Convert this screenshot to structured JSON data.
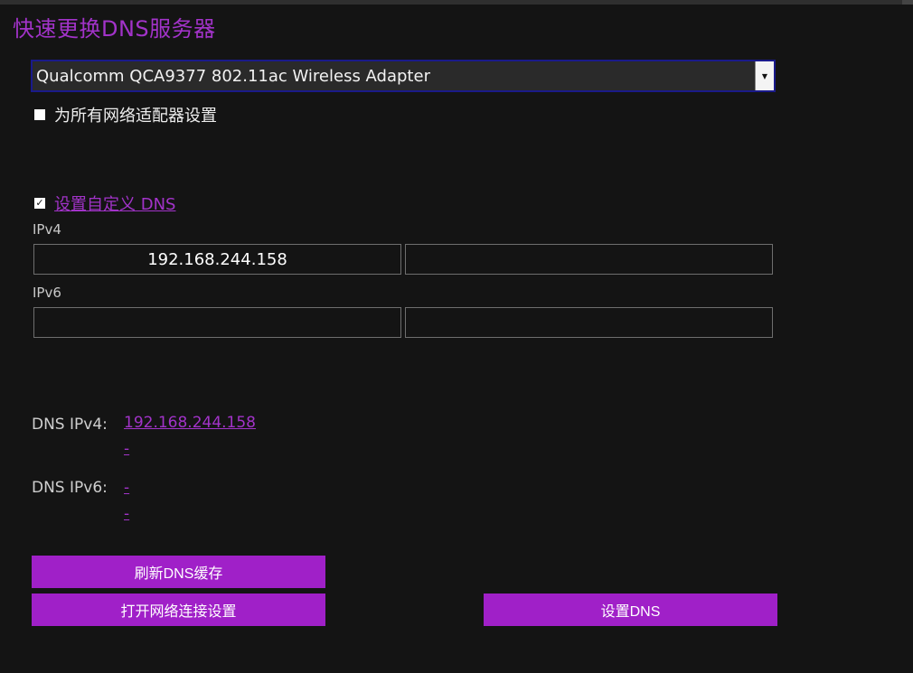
{
  "app": {
    "title": "快速更换DNS服务器"
  },
  "adapter": {
    "selected": "Qualcomm QCA9377 802.11ac Wireless Adapter"
  },
  "all_adapters": {
    "label": "为所有网络适配器设置",
    "checked": false
  },
  "custom_dns": {
    "label": "设置自定义 DNS",
    "checked": true
  },
  "ipv4": {
    "label": "IPv4",
    "primary": "192.168.244.158",
    "secondary": ""
  },
  "ipv6": {
    "label": "IPv6",
    "primary": "",
    "secondary": ""
  },
  "current_dns": {
    "ipv4_label": "DNS IPv4:",
    "ipv4_primary": "192.168.244.158",
    "ipv4_secondary": "-",
    "ipv6_label": "DNS IPv6:",
    "ipv6_primary": "-",
    "ipv6_secondary": "-"
  },
  "buttons": {
    "flush": "刷新DNS缓存",
    "open_network": "打开网络连接设置",
    "set_dns": "设置DNS"
  },
  "colors": {
    "accent": "#a020c8",
    "background": "#141414",
    "select_border": "#1a1a8a"
  }
}
